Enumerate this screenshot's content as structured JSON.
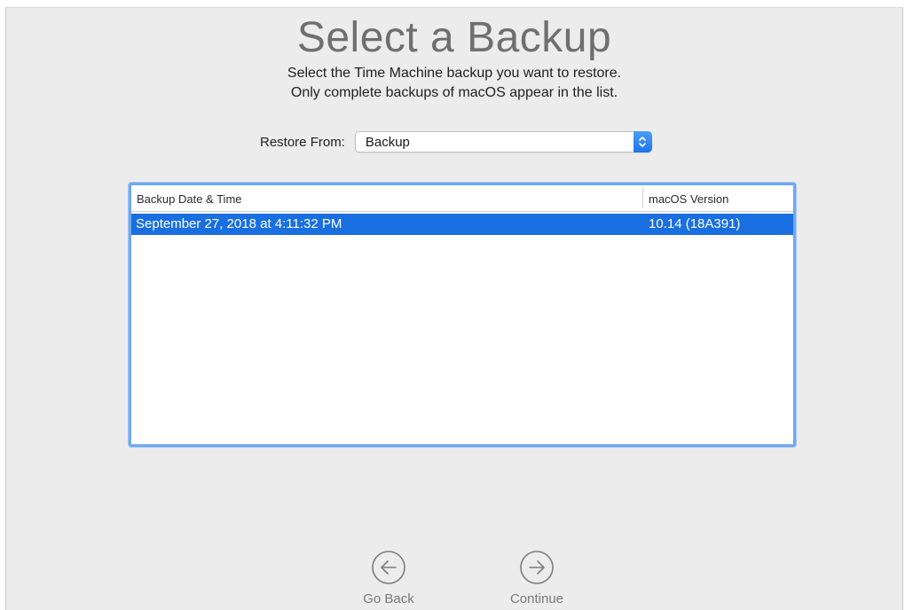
{
  "title": "Select a Backup",
  "subtitle_lines": [
    "Select the Time Machine backup you want to restore.",
    "Only complete backups of macOS appear in the list."
  ],
  "restore_from": {
    "label": "Restore From:",
    "selected": "Backup"
  },
  "table": {
    "columns": [
      "Backup Date & Time",
      "macOS Version"
    ],
    "rows": [
      {
        "date": "September 27, 2018 at 4:11:32 PM",
        "version": "10.14 (18A391)",
        "selected": true
      }
    ]
  },
  "buttons": {
    "go_back": "Go Back",
    "continue": "Continue"
  },
  "icons": {
    "popup": "up-down-chevrons-icon",
    "back": "left-arrow-circle-icon",
    "continue": "right-arrow-circle-icon"
  },
  "colors": {
    "selection": "#1a6fe0",
    "focus_ring": "#6fa8ee",
    "popup_accent": "#1e74ea"
  }
}
